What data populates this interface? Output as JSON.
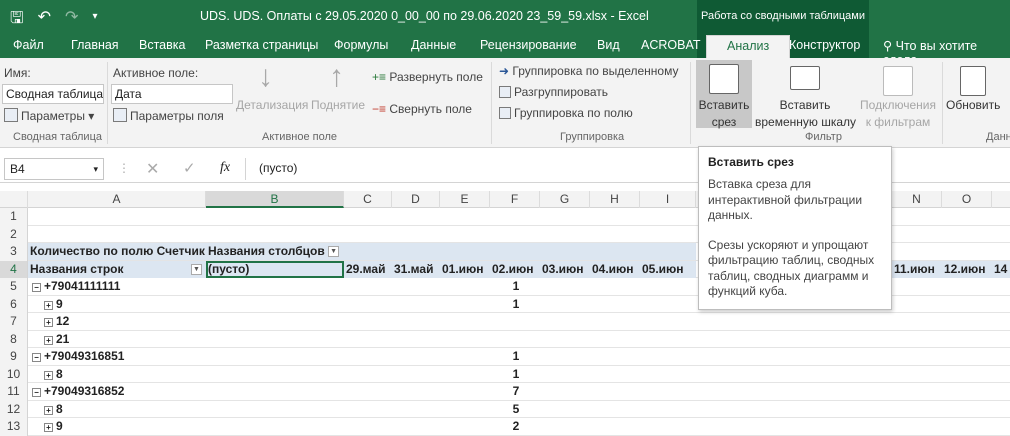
{
  "app": {
    "title": "UDS. UDS. Оплаты с 29.05.2020 0_00_00 по 29.06.2020 23_59_59.xlsx - Excel",
    "context_title": "Работа со сводными таблицами"
  },
  "tabs": [
    "Файл",
    "Главная",
    "Вставка",
    "Разметка страницы",
    "Формулы",
    "Данные",
    "Рецензирование",
    "Вид",
    "ACROBAT",
    "Анализ",
    "Конструктор"
  ],
  "tell_me": "Что вы хотите сдела",
  "ribbon": {
    "name_label": "Имя:",
    "name_value": "Сводная таблица1",
    "params_label": "Параметры",
    "group_pivot": "Сводная таблица",
    "active_field_label": "Активное поле:",
    "active_field_value": "Дата",
    "field_params": "Параметры поля",
    "drill_down": "Детализация",
    "drill_up": "Поднятие",
    "expand_field": "Развернуть поле",
    "collapse_field": "Свернуть поле",
    "group_active_field": "Активное поле",
    "group_selection": "Группировка по выделенному",
    "ungroup": "Разгруппировать",
    "group_field": "Группировка по полю",
    "group_grouping": "Группировка",
    "insert_slicer_1": "Вставить",
    "insert_slicer_2": "срез",
    "insert_timeline_1": "Вставить",
    "insert_timeline_2": "временную шкалу",
    "filter_conn_1": "Подключения",
    "filter_conn_2": "к фильтрам",
    "group_filter": "Фильтр",
    "refresh": "Обновить",
    "group_data": "Данны"
  },
  "formula_bar": {
    "cell_ref": "B4",
    "fx": "fx",
    "value": "(пусто)"
  },
  "columns": [
    "A",
    "B",
    "C",
    "D",
    "E",
    "F",
    "G",
    "H",
    "I",
    "",
    "",
    "N",
    "O"
  ],
  "rows": [
    "1",
    "2",
    "3",
    "4",
    "5",
    "6",
    "7",
    "8",
    "9",
    "10",
    "11",
    "12",
    "13"
  ],
  "pivot": {
    "count_label": "Количество по полю Счетчик",
    "col_labels": "Названия столбцов",
    "row_labels": "Названия строк",
    "blank": "(пусто)",
    "dates": [
      "29.май",
      "31.май",
      "01.июн",
      "02.июн",
      "03.июн",
      "04.июн",
      "05.июн",
      "11.июн",
      "12.июн",
      "14"
    ],
    "items": [
      {
        "label": "+79041111111",
        "level": 0,
        "value": "1"
      },
      {
        "label": "9",
        "level": 1,
        "value": "1"
      },
      {
        "label": "12",
        "level": 1,
        "value": ""
      },
      {
        "label": "21",
        "level": 1,
        "value": ""
      },
      {
        "label": "+79049316851",
        "level": 0,
        "value": "1"
      },
      {
        "label": "8",
        "level": 1,
        "value": "1"
      },
      {
        "label": "+79049316852",
        "level": 0,
        "value": "7"
      },
      {
        "label": "8",
        "level": 1,
        "value": "5"
      },
      {
        "label": "9",
        "level": 1,
        "value": "2"
      }
    ]
  },
  "tooltip": {
    "title": "Вставить срез",
    "p1": "Вставка среза для интерактивной фильтрации данных.",
    "p2": "Срезы ускоряют и упрощают фильтрацию таблиц, сводных таблиц, сводных диаграмм и функций куба."
  },
  "colors": {
    "excel_green": "#217346",
    "pivot_header": "#dce6f1"
  }
}
